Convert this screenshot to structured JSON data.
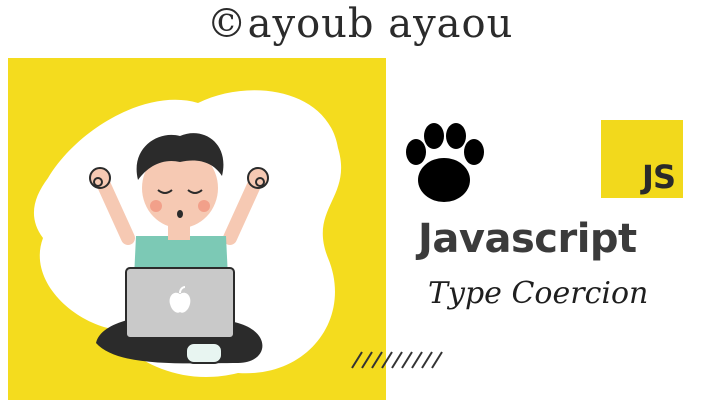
{
  "watermark": {
    "text": "©ayoub ayaou"
  },
  "card": {
    "logo_text": "JS",
    "title": "Javascript",
    "subtitle": "Type Coercion"
  },
  "colors": {
    "accent_yellow": "#f4dc1e",
    "text_dark": "#3b3b3b",
    "shirt_teal": "#7cc9b5",
    "laptop_gray": "#c9c9c9"
  },
  "icons": [
    "paw-print-icon",
    "apple-logo-icon",
    "hatch-lines-icon"
  ]
}
